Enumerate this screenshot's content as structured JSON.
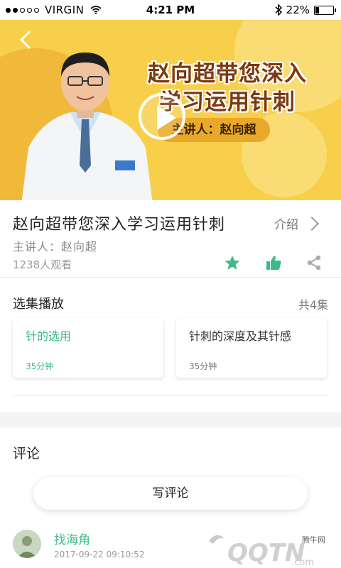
{
  "status_bar": {
    "carrier": "VIRGIN",
    "time": "4:21 PM",
    "battery": "22%",
    "battery_level": 0.22
  },
  "banner": {
    "title_line1": "赵向超带您深入",
    "title_line2": "学习运用针刺",
    "speaker_tag": "主讲人：赵向超"
  },
  "course": {
    "title": "赵向超带您深入学习运用针刺",
    "intro_label": "介绍",
    "speaker": "主讲人：赵向超",
    "views": "1238人观看"
  },
  "episodes": {
    "heading": "选集播放",
    "count": "共4集",
    "items": [
      {
        "name": "针的选用",
        "duration": "35分钟"
      },
      {
        "name": "针刺的深度及其针感",
        "duration": "35分钟"
      }
    ]
  },
  "comments": {
    "heading": "评论",
    "write_label": "写评论",
    "items": [
      {
        "user": "找海角",
        "time": "2017-09-22  09:10:52"
      }
    ]
  },
  "watermark": {
    "text": "腾牛网"
  },
  "colors": {
    "accent": "#3fba86",
    "banner": "#f7cf4a"
  },
  "icons": [
    "back-icon",
    "play-icon",
    "star-icon",
    "thumbs-up-icon",
    "share-icon",
    "chevron-right-icon",
    "wifi-icon",
    "bluetooth-icon",
    "battery-icon"
  ]
}
